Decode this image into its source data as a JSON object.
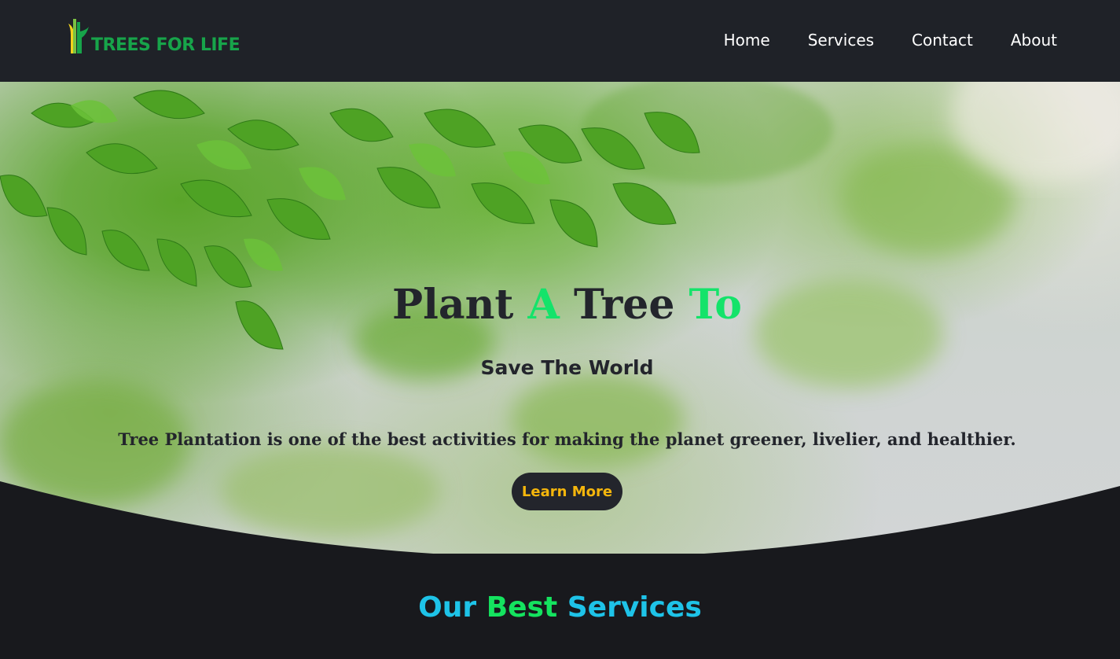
{
  "brand": {
    "name": "TREES FOR LIFE",
    "colors": {
      "logo_green": "#17a44a",
      "logo_yellow": "#f3d21b",
      "logo_light_green": "#7ac142"
    }
  },
  "nav": {
    "items": [
      {
        "label": "Home"
      },
      {
        "label": "Services"
      },
      {
        "label": "Contact"
      },
      {
        "label": "About"
      }
    ]
  },
  "hero": {
    "title_parts": [
      {
        "text": "Plant ",
        "accent": false
      },
      {
        "text": "A",
        "accent": true
      },
      {
        "text": " Tree ",
        "accent": false
      },
      {
        "text": "To",
        "accent": true
      }
    ],
    "subtitle": "Save The World",
    "description": "Tree Plantation is one of the best activities for making the planet greener, livelier, and healthier.",
    "cta_label": "Learn More",
    "colors": {
      "accent": "#14e36a",
      "text": "#23252c",
      "cta_text": "#f5b60c"
    }
  },
  "services": {
    "title_parts": [
      {
        "text": "Our ",
        "color": "#1ec3e8"
      },
      {
        "text": "Best",
        "color": "#14e35f"
      },
      {
        "text": " Services",
        "color": "#1ec3e8"
      }
    ]
  },
  "icons": {
    "logo_mark": "tree-stalks-icon"
  }
}
